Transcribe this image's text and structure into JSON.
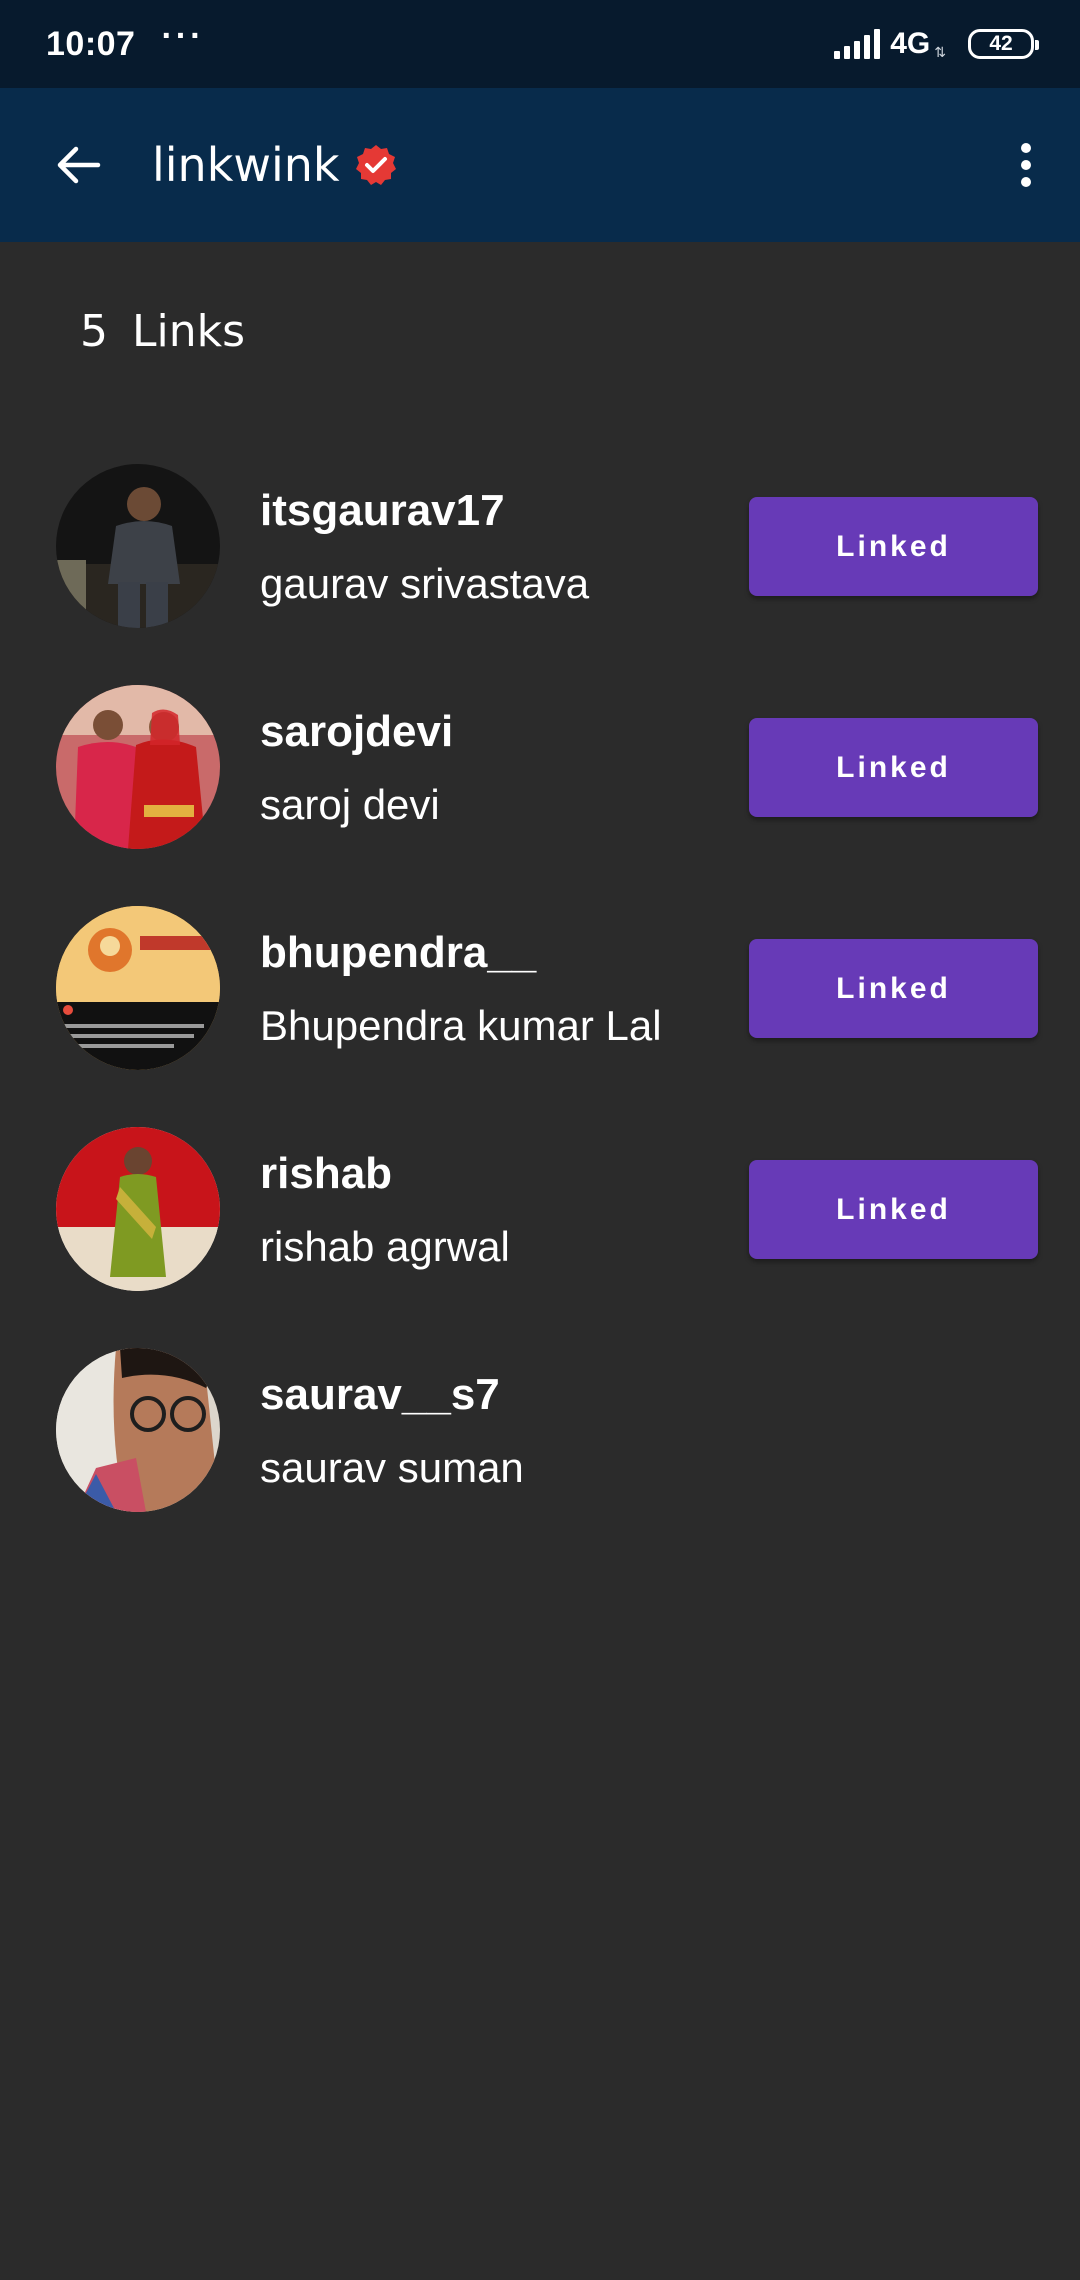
{
  "status_bar": {
    "time": "10:07",
    "dots": "···",
    "network": "4G",
    "battery": "42"
  },
  "app_bar": {
    "title": "linkwink"
  },
  "links_header": {
    "count_label": "5  Links"
  },
  "colors": {
    "status_bar_bg": "#071a2d",
    "app_bar_bg": "#082b4b",
    "page_bg": "#2b2b2b",
    "button_bg": "#673ab7",
    "verified_badge": "#e53935"
  },
  "links": [
    {
      "username": "itsgaurav17",
      "fullname": "gaurav srivastava",
      "button": "Linked"
    },
    {
      "username": "sarojdevi",
      "fullname": "saroj devi",
      "button": "Linked"
    },
    {
      "username": "bhupendra__",
      "fullname": "Bhupendra kumar Lal",
      "button": "Linked"
    },
    {
      "username": "rishab",
      "fullname": "rishab agrwal",
      "button": "Linked"
    },
    {
      "username": "saurav__s7",
      "fullname": "saurav suman"
    }
  ]
}
